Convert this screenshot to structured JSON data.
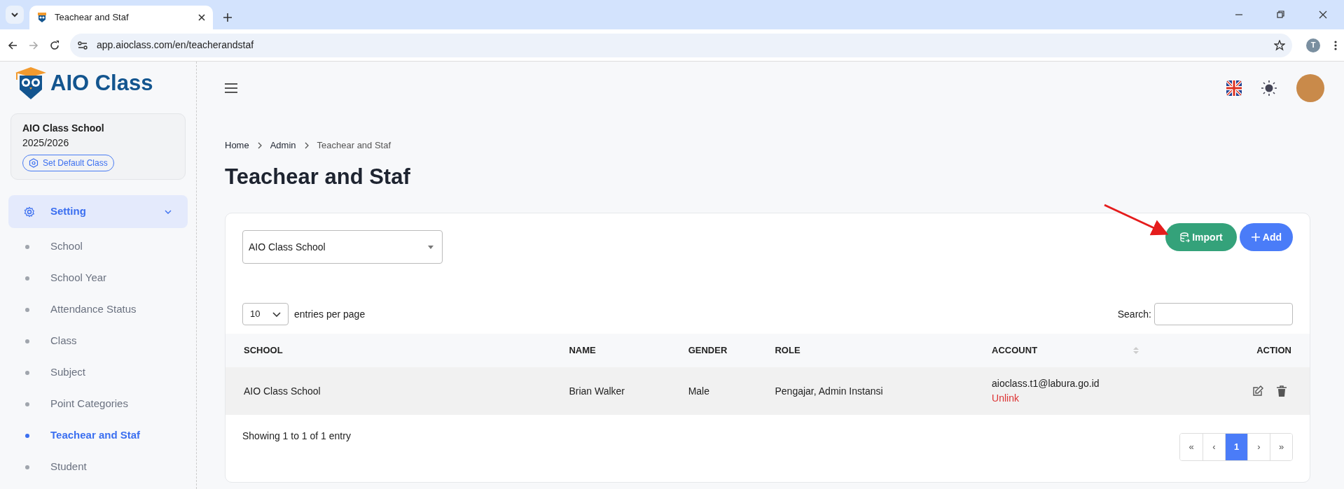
{
  "browser": {
    "tab_title": "Teachear and Staf",
    "url": "app.aioclass.com/en/teacherandstaf",
    "profile_initial": "T"
  },
  "sidebar": {
    "brand": "AIO Class",
    "school_card": {
      "name": "AIO Class School",
      "year": "2025/2026",
      "button": "Set Default Class"
    },
    "menu": {
      "label": "Setting",
      "expanded": true,
      "items": [
        {
          "label": "School",
          "selected": false
        },
        {
          "label": "School Year",
          "selected": false
        },
        {
          "label": "Attendance Status",
          "selected": false
        },
        {
          "label": "Class",
          "selected": false
        },
        {
          "label": "Subject",
          "selected": false
        },
        {
          "label": "Point Categories",
          "selected": false
        },
        {
          "label": "Teachear and Staf",
          "selected": true
        },
        {
          "label": "Student",
          "selected": false
        }
      ]
    }
  },
  "breadcrumb": [
    {
      "label": "Home",
      "current": false
    },
    {
      "label": "Admin",
      "current": false
    },
    {
      "label": "Teachear and Staf",
      "current": true
    }
  ],
  "page_title": "Teachear and Staf",
  "school_filter": {
    "value": "AIO Class School"
  },
  "buttons": [
    {
      "kind": "import",
      "label": "Import"
    },
    {
      "kind": "add",
      "label": "Add"
    }
  ],
  "table_controls": {
    "page_size": "10",
    "entries_label": "entries per page",
    "search_label": "Search:"
  },
  "table": {
    "columns": [
      {
        "label": "SCHOOL",
        "sortable": false
      },
      {
        "label": "NAME",
        "sortable": false
      },
      {
        "label": "GENDER",
        "sortable": false
      },
      {
        "label": "ROLE",
        "sortable": false
      },
      {
        "label": "ACCOUNT",
        "sortable": true
      },
      {
        "label": "ACTION",
        "sortable": false
      }
    ],
    "rows": [
      {
        "school": "AIO Class School",
        "name": "Brian Walker",
        "gender": "Male",
        "role": "Pengajar, Admin Instansi",
        "account": "aioclass.t1@labura.go.id",
        "account_action": "Unlink"
      }
    ]
  },
  "info": "Showing 1 to 1 of 1 entry",
  "pagination": [
    {
      "label": "«",
      "selected": false
    },
    {
      "label": "‹",
      "selected": false
    },
    {
      "label": "1",
      "selected": true
    },
    {
      "label": "›",
      "selected": false
    },
    {
      "label": "»",
      "selected": false
    }
  ]
}
